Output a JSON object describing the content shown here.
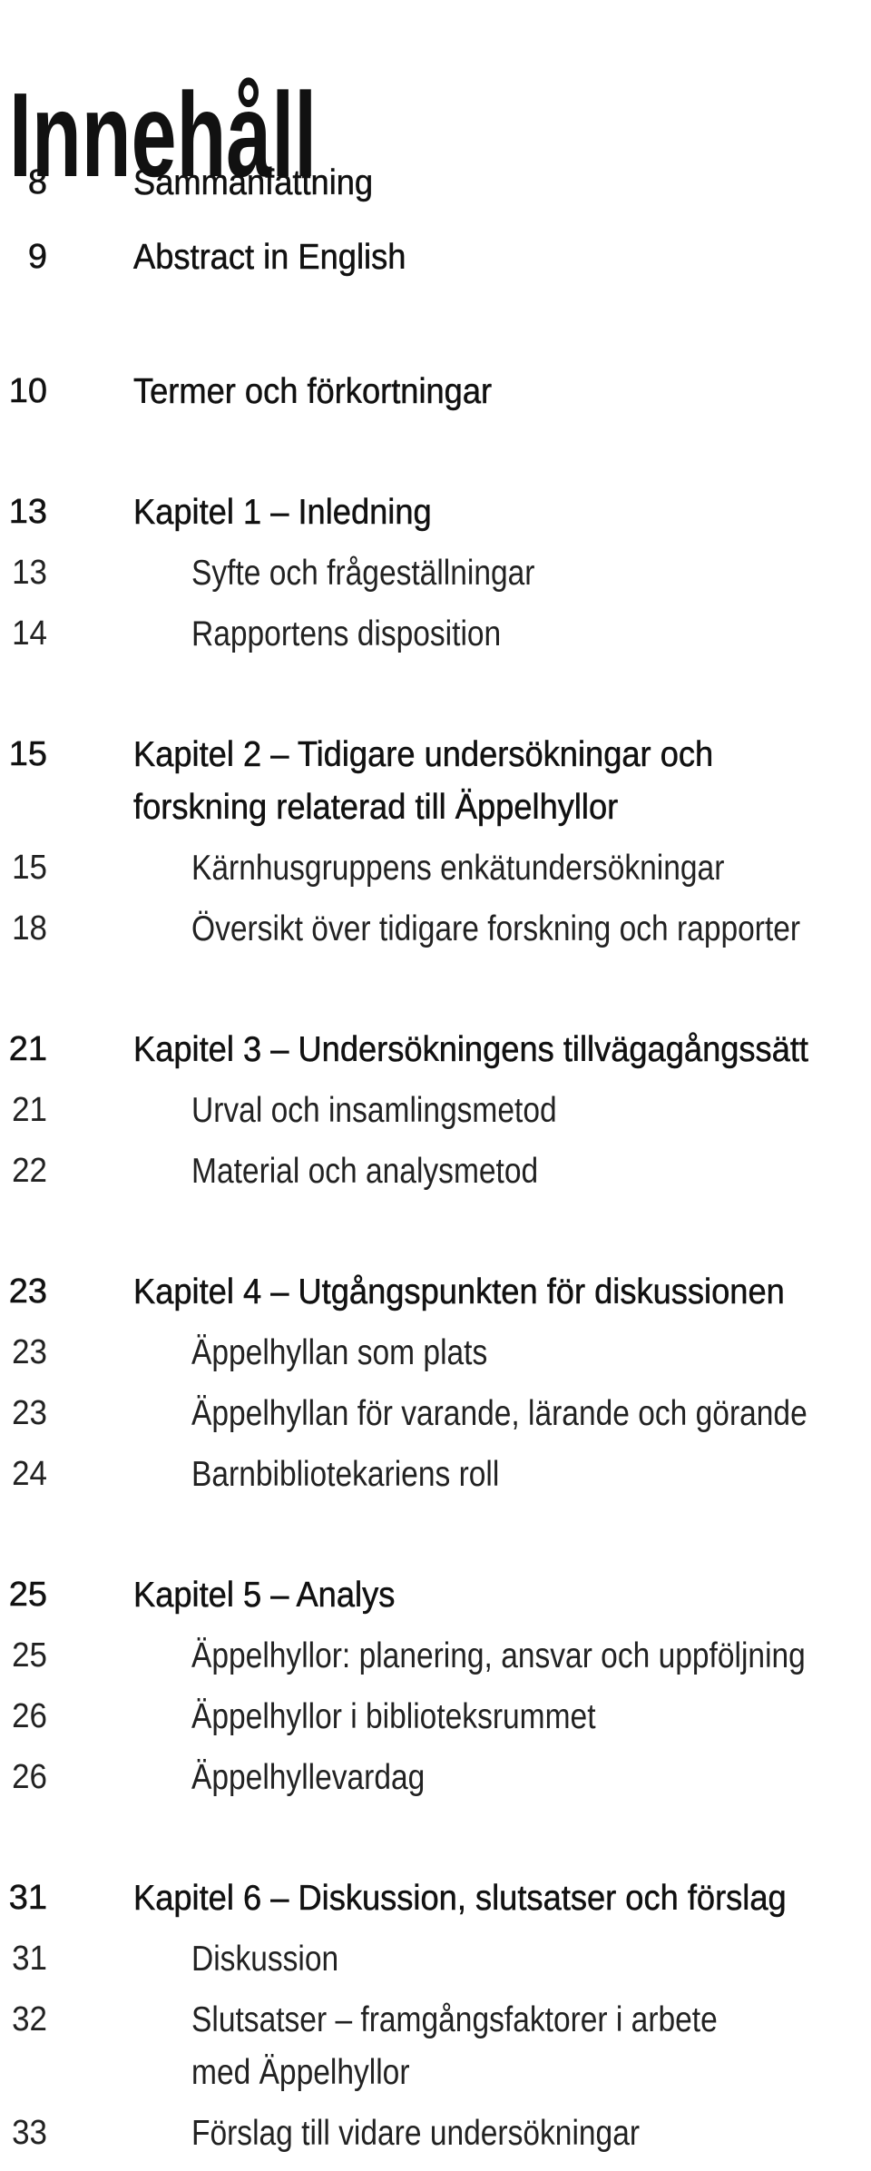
{
  "title": "Innehåll",
  "groups": [
    {
      "items": [
        {
          "page": "8",
          "level": "main",
          "lines": [
            "Sammanfattning"
          ]
        },
        {
          "page": "9",
          "level": "main",
          "lines": [
            "Abstract in English"
          ]
        }
      ]
    },
    {
      "items": [
        {
          "page": "10",
          "level": "main",
          "lines": [
            "Termer och förkortningar"
          ]
        }
      ]
    },
    {
      "items": [
        {
          "page": "13",
          "level": "main",
          "lines": [
            "Kapitel 1 – Inledning"
          ]
        },
        {
          "page": "13",
          "level": "sub",
          "lines": [
            "Syfte och frågeställningar"
          ]
        },
        {
          "page": "14",
          "level": "sub",
          "lines": [
            "Rapportens disposition"
          ]
        }
      ]
    },
    {
      "items": [
        {
          "page": "15",
          "level": "main",
          "lines": [
            "Kapitel 2 – Tidigare undersökningar och",
            "forskning relaterad till Äppelhyllor"
          ]
        },
        {
          "page": "15",
          "level": "sub",
          "lines": [
            "Kärnhusgruppens enkätundersökningar"
          ]
        },
        {
          "page": "18",
          "level": "sub",
          "lines": [
            "Översikt över tidigare forskning och rapporter"
          ]
        }
      ]
    },
    {
      "items": [
        {
          "page": "21",
          "level": "main",
          "lines": [
            "Kapitel 3 – Undersökningens tillvägagångssätt"
          ]
        },
        {
          "page": "21",
          "level": "sub",
          "lines": [
            "Urval och insamlingsmetod"
          ]
        },
        {
          "page": "22",
          "level": "sub",
          "lines": [
            "Material och analysmetod"
          ]
        }
      ]
    },
    {
      "items": [
        {
          "page": "23",
          "level": "main",
          "lines": [
            "Kapitel 4 – Utgångspunkten för diskussionen"
          ]
        },
        {
          "page": "23",
          "level": "sub",
          "lines": [
            "Äppelhyllan som plats"
          ]
        },
        {
          "page": "23",
          "level": "sub",
          "lines": [
            "Äppelhyllan för varande, lärande och görande"
          ]
        },
        {
          "page": "24",
          "level": "sub",
          "lines": [
            "Barnbibliotekariens roll"
          ]
        }
      ]
    },
    {
      "items": [
        {
          "page": "25",
          "level": "main",
          "lines": [
            "Kapitel 5 – Analys"
          ]
        },
        {
          "page": "25",
          "level": "sub",
          "lines": [
            "Äppelhyllor: planering, ansvar och uppföljning"
          ]
        },
        {
          "page": "26",
          "level": "sub",
          "lines": [
            "Äppelhyllor i biblioteksrummet"
          ]
        },
        {
          "page": "26",
          "level": "sub",
          "lines": [
            "Äppelhyllevardag"
          ]
        }
      ]
    },
    {
      "items": [
        {
          "page": "31",
          "level": "main",
          "lines": [
            "Kapitel 6 – Diskussion, slutsatser och förslag"
          ]
        },
        {
          "page": "31",
          "level": "sub",
          "lines": [
            "Diskussion"
          ]
        },
        {
          "page": "32",
          "level": "sub",
          "lines": [
            "Slutsatser – framgångsfaktorer i arbete",
            "med Äppelhyllor"
          ]
        },
        {
          "page": "33",
          "level": "sub",
          "lines": [
            "Förslag till vidare undersökningar"
          ]
        }
      ]
    }
  ]
}
